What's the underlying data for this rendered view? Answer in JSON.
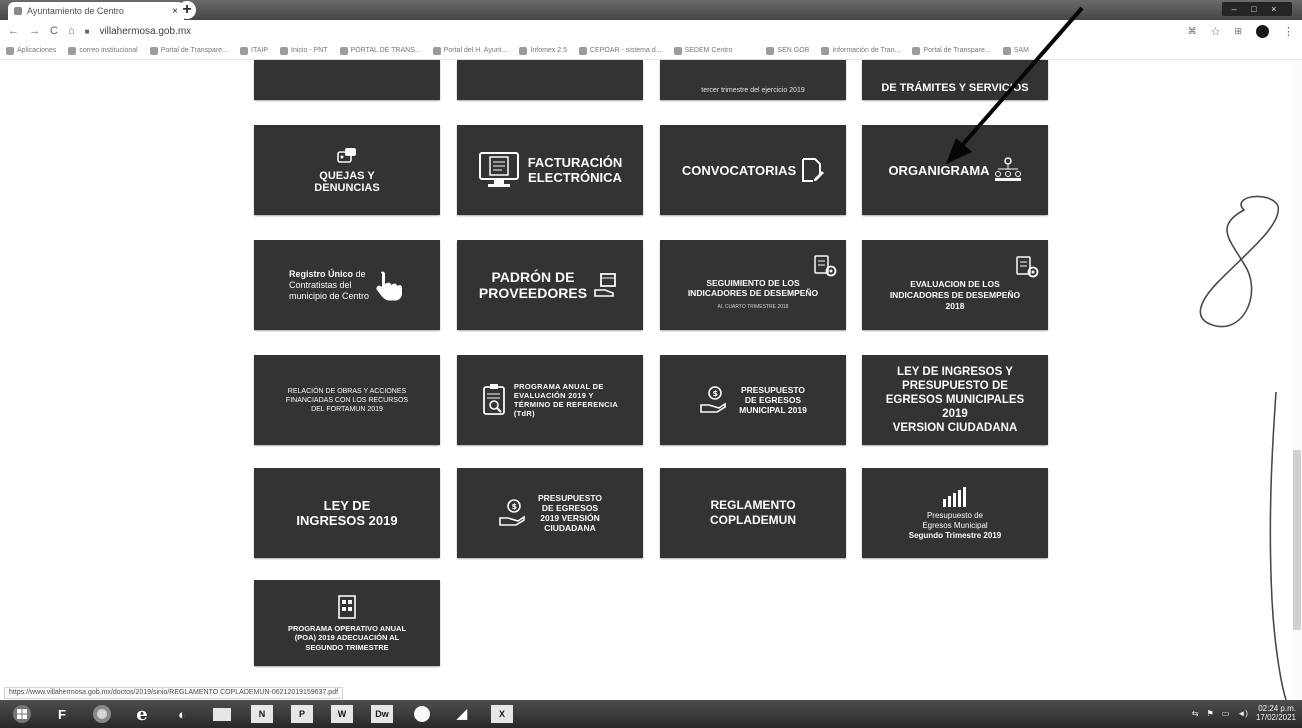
{
  "browser": {
    "tab_title": "Ayuntamiento de Centro",
    "tab_close": "×",
    "new_tab": "+",
    "window_controls": "– □ ×",
    "url": "villahermosa.gob.mx",
    "bookmarks": [
      "Aplicaciones",
      "correo institucional",
      "Portal de Transpare...",
      "ITAIP",
      "Inicio - PNT",
      "PORTAL DE TRANS...",
      "Portal del H. Ayunt...",
      "Infomex 2.5",
      "CEPOAR - sistema d...",
      "SEDEM Centro",
      "SEN GOB",
      "Información de Tran...",
      "Portal de Transpare...",
      "SAM"
    ]
  },
  "tiles": {
    "quejas": "QUEJAS Y\nDENUNCIAS",
    "facturacion": "FACTURACIÓN\nELECTRÓNICA",
    "convocatorias": "CONVOCATORIAS",
    "organigrama": "ORGANIGRAMA",
    "registro_bold": "Registro Único",
    "registro_rest": " de\nContratistas del\nmunicipio de Centro",
    "padron": "PADRÓN DE\nPROVEEDORES",
    "seguimiento": "SEGUIMIENTO DE LOS\nINDICADORES DE DESEMPEÑO",
    "seguimiento_sub": "AL CUARTO TRIMESTRE 2018",
    "evaluacion": "EVALUACION DE LOS\nINDICADORES DE DESEMPEÑO\n2018",
    "relacion": "RELACIÓN DE OBRAS Y ACCIONES\nFINANCIADAS CON LOS RECURSOS\nDEL FORTAMUN 2019",
    "programa": "PROGRAMA ANUAL DE\nEVALUACIÓN 2019 Y\nTÉRMINO DE REFERENCIA\n(TdR)",
    "presupuesto_egresos": "PRESUPUESTO\nDE EGRESOS\nMUNICIPAL 2019",
    "ley_presupuesto": "LEY DE INGRESOS Y\nPRESUPUESTO DE\nEGRESOS MUNICIPALES\n2019\nVERSION CIUDADANA",
    "ley_ingresos": "LEY DE\nINGRESOS 2019",
    "presupuesto_ciudadana": "PRESUPUESTO\nDE EGRESOS\n2019 VERSIÓN\nCIUDADANA",
    "reglamento": "REGLAMENTO\nCOPLADEMUN",
    "presupuesto_trim": "Presupuesto de\nEgresos Municipal",
    "presupuesto_trim_bold": "Segundo Trimestre 2019",
    "poa": "PROGRAMA OPERATIVO ANUAL\n(POA) 2019 ADECUACIÓN AL\nSEGUNDO TRIMESTRE",
    "top_left3": "tercer trimestre del ejercicio 2019",
    "top_right4": "DE TRÁMITES Y SERVICIOS"
  },
  "status_url": "https://www.villahermosa.gob.mx/doctos/2019/sinio/REGLAMENTO COPLADEMUN-06212019159637.pdf",
  "taskbar": {
    "items": [
      "F",
      "e",
      "N",
      "P",
      "W",
      "Dw",
      "X"
    ],
    "time": "02:24 p.m.",
    "date": "17/02/2021"
  },
  "annotation": {
    "handwritten": "8",
    "colors": {
      "ink": "#2a4ea8",
      "arrow": "#111111"
    }
  }
}
